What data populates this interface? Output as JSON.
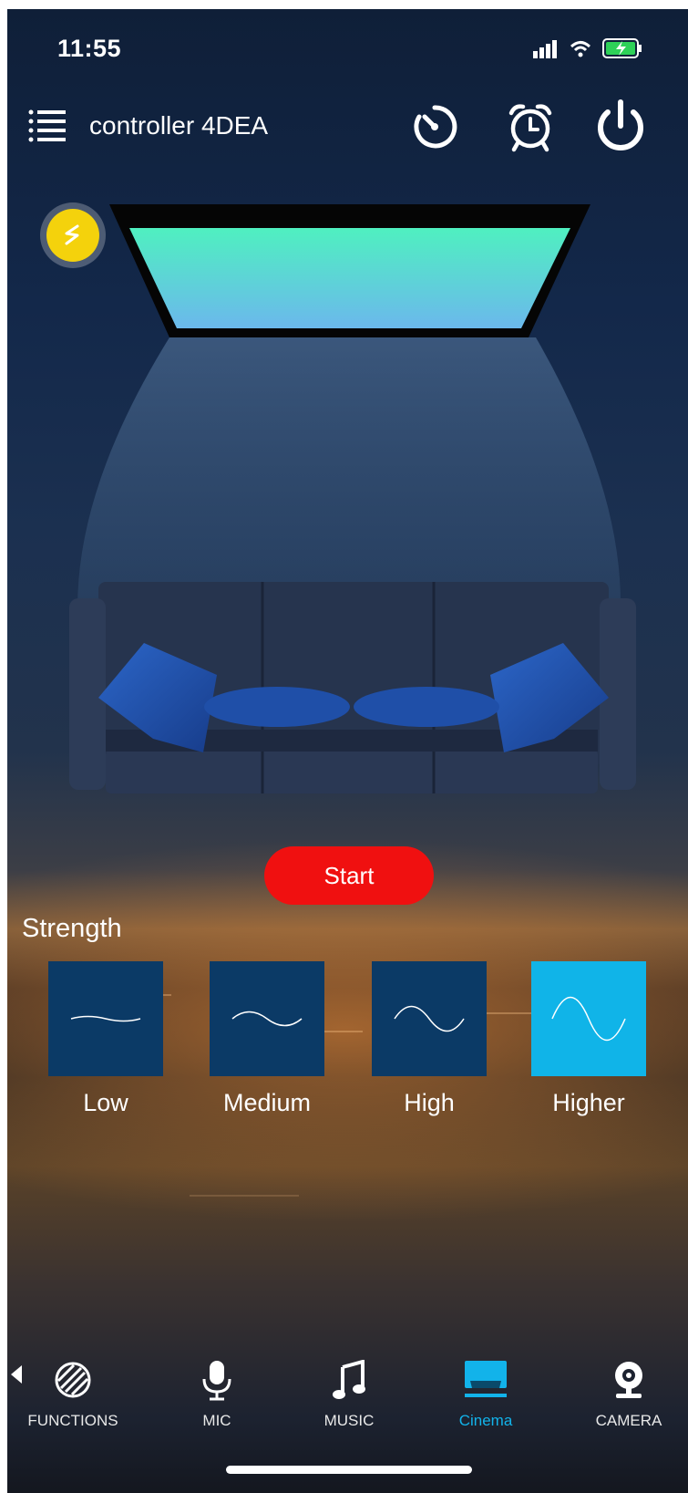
{
  "status_bar": {
    "time": "11:55"
  },
  "header": {
    "title": "controller 4DEA"
  },
  "main": {
    "start_label": "Start",
    "strength_label": "Strength",
    "strength_options": [
      {
        "label": "Low",
        "selected": false
      },
      {
        "label": "Medium",
        "selected": false
      },
      {
        "label": "High",
        "selected": false
      },
      {
        "label": "Higher",
        "selected": true
      }
    ]
  },
  "bottom_nav": {
    "items": [
      {
        "label": "FUNCTIONS",
        "icon": "functions-icon"
      },
      {
        "label": "MIC",
        "icon": "microphone-icon"
      },
      {
        "label": "MUSIC",
        "icon": "music-note-icon"
      },
      {
        "label": "Cinema",
        "icon": "cinema-icon",
        "active": true
      },
      {
        "label": "CAMERA",
        "icon": "camera-icon"
      }
    ]
  },
  "colors": {
    "accent": "#12b3ea",
    "start_button": "#f01010",
    "tile": "#0b3a66",
    "tile_active": "#10b4e8",
    "mode_badge": "#f4d20c"
  }
}
